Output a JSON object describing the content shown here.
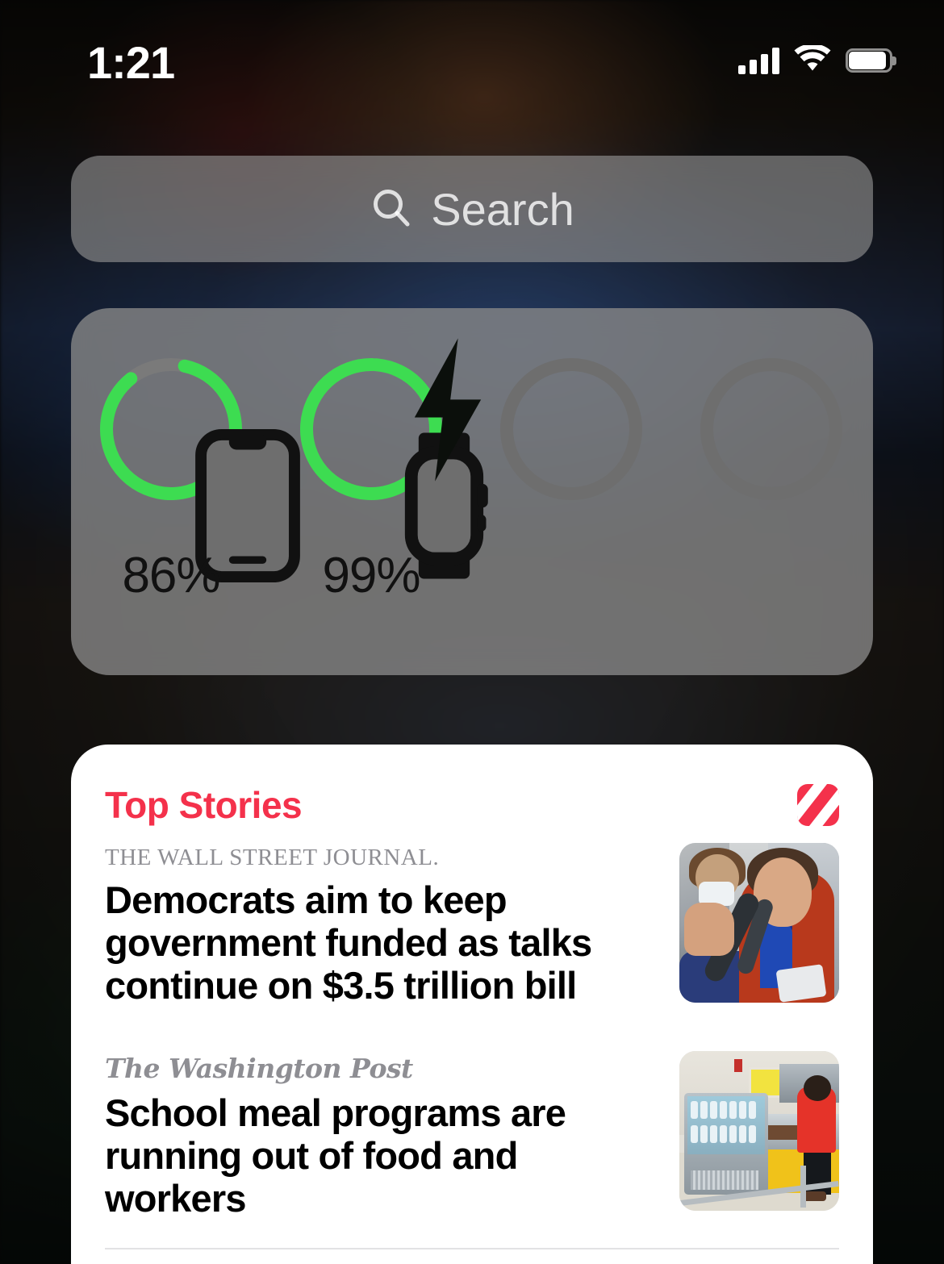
{
  "status_bar": {
    "time": "1:21",
    "cellular_icon": "cellular-signal-icon",
    "cellular_bars": 4,
    "wifi_icon": "wifi-icon",
    "battery_icon": "battery-icon"
  },
  "search": {
    "placeholder": "Search",
    "icon": "search-icon"
  },
  "battery_widget": {
    "devices": [
      {
        "name": "iPhone",
        "icon": "iphone-icon",
        "percent": 86,
        "percent_label": "86%",
        "charging": false,
        "ring_color": "#3ddc51",
        "track_color": "#7a7a7a"
      },
      {
        "name": "Apple Watch",
        "icon": "apple-watch-icon",
        "percent": 99,
        "percent_label": "99%",
        "charging": true,
        "charging_icon": "charging-bolt-icon",
        "ring_color": "#3ddc51",
        "track_color": "#7a7a7a"
      },
      {
        "name": "",
        "icon": "",
        "percent": 0,
        "percent_label": "",
        "charging": false,
        "ring_color": "",
        "track_color": "#6e6e6e"
      },
      {
        "name": "",
        "icon": "",
        "percent": 0,
        "percent_label": "",
        "charging": false,
        "ring_color": "",
        "track_color": "#6e6e6e"
      }
    ]
  },
  "news_widget": {
    "title": "Top Stories",
    "logo_icon": "apple-news-logo-icon",
    "accent_color": "#f4314b",
    "stories": [
      {
        "publisher": "THE WALL STREET JOURNAL.",
        "headline": "Democrats aim to keep government funded as talks continue on $3.5 trillion bill",
        "thumbnail": "nancy-pelosi-press-scrum-photo"
      },
      {
        "publisher": "The Washington Post",
        "headline": "School meal programs are running out of food and workers",
        "thumbnail": "school-cafeteria-worker-photo"
      }
    ]
  }
}
